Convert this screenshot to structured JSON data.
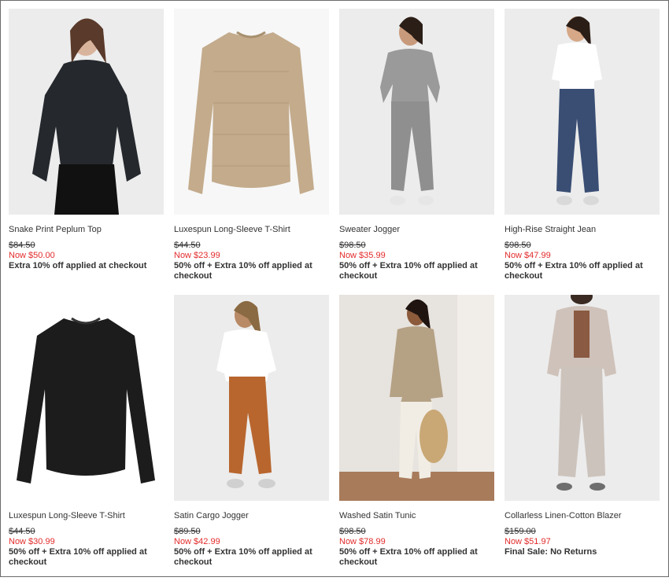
{
  "products": [
    {
      "name": "Snake Print Peplum Top",
      "original_price": "$84.50",
      "now_price": "Now $50.00",
      "promo": "Extra 10% off applied at checkout"
    },
    {
      "name": "Luxespun Long-Sleeve T-Shirt",
      "original_price": "$44.50",
      "now_price": "Now $23.99",
      "promo": "50% off + Extra 10% off applied at checkout"
    },
    {
      "name": "Sweater Jogger",
      "original_price": "$98.50",
      "now_price": "Now $35.99",
      "promo": "50% off + Extra 10% off applied at checkout"
    },
    {
      "name": "High-Rise Straight Jean",
      "original_price": "$98.50",
      "now_price": "Now $47.99",
      "promo": "50% off + Extra 10% off applied at checkout"
    },
    {
      "name": "Luxespun Long-Sleeve T-Shirt",
      "original_price": "$44.50",
      "now_price": "Now $30.99",
      "promo": "50% off + Extra 10% off applied at checkout"
    },
    {
      "name": "Satin Cargo Jogger",
      "original_price": "$89.50",
      "now_price": "Now $42.99",
      "promo": "50% off + Extra 10% off applied at checkout"
    },
    {
      "name": "Washed Satin Tunic",
      "original_price": "$98.50",
      "now_price": "Now $78.99",
      "promo": "50% off + Extra 10% off applied at checkout"
    },
    {
      "name": "Collarless Linen-Cotton Blazer",
      "original_price": "$159.00",
      "now_price": "Now $51.97",
      "promo": "Final Sale: No Returns"
    }
  ],
  "colors": {
    "sale_red": "#e32b2b",
    "text": "#333333",
    "image_bg": "#f3f3f3"
  }
}
